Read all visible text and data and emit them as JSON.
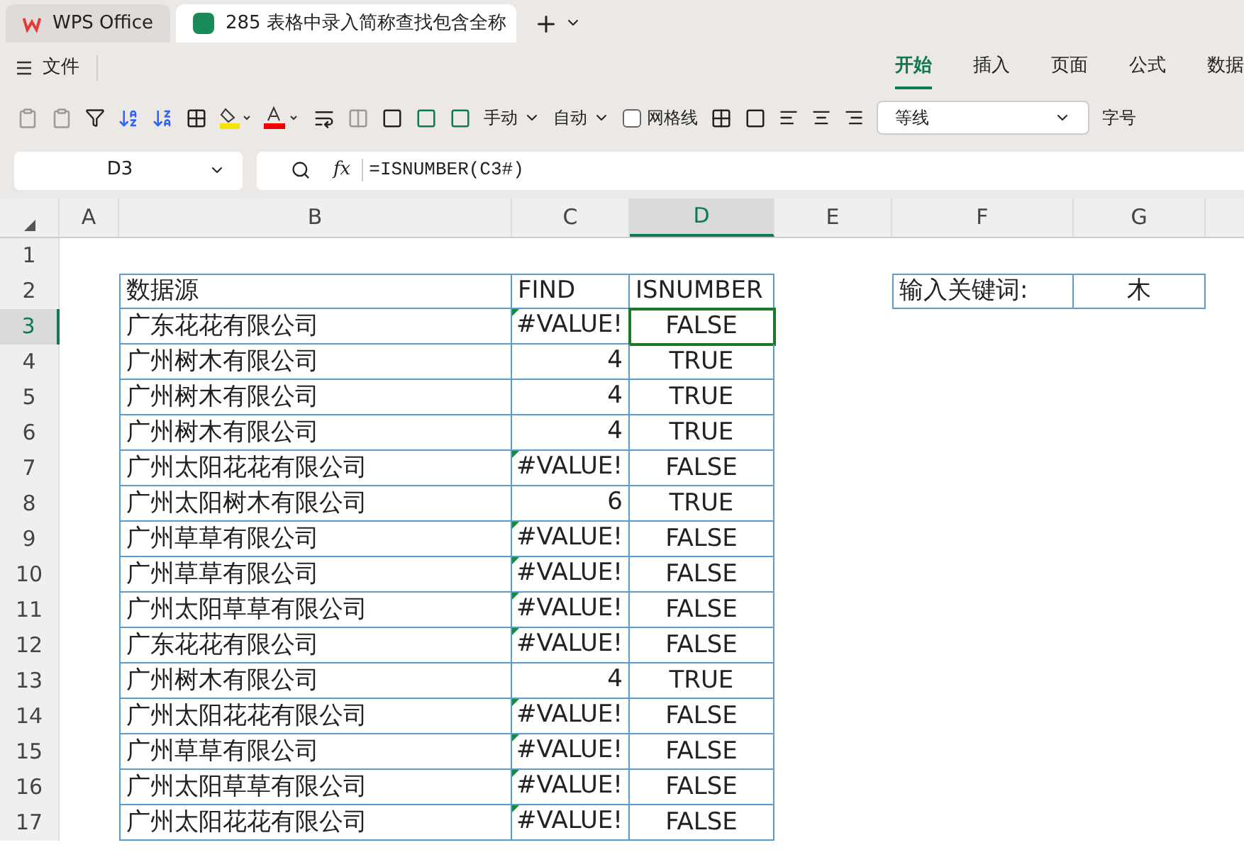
{
  "tabs": [
    {
      "kind": "home",
      "label": "WPS Office",
      "selected": false
    },
    {
      "kind": "doc",
      "label": "285 表格中录入简称查找包含全称",
      "selected": true
    }
  ],
  "menu": {
    "file": "文件",
    "ribbon_tabs": [
      {
        "label": "开始",
        "selected": true
      },
      {
        "label": "插入",
        "selected": false
      },
      {
        "label": "页面",
        "selected": false
      },
      {
        "label": "公式",
        "selected": false
      },
      {
        "label": "数据",
        "selected": false
      }
    ]
  },
  "toolbar": {
    "row_height": "手动",
    "col_width": "自动",
    "gridlines": {
      "label": "网格线",
      "checked": false
    },
    "font": "等线",
    "font_size_label": "字号"
  },
  "formula_bar": {
    "cell_ref": "D3",
    "fx": "fx",
    "formula": "=ISNUMBER(C3#)"
  },
  "sheet": {
    "columns": [
      {
        "label": "A",
        "selected": false
      },
      {
        "label": "B",
        "selected": false
      },
      {
        "label": "C",
        "selected": false
      },
      {
        "label": "D",
        "selected": true
      },
      {
        "label": "E",
        "selected": false
      },
      {
        "label": "F",
        "selected": false
      },
      {
        "label": "G",
        "selected": false
      }
    ],
    "header": {
      "b": "数据源",
      "c": "FIND",
      "d": "ISNUMBER",
      "f": "输入关键词:",
      "g": "木"
    },
    "rows": [
      {
        "num": "1",
        "selected": false
      },
      {
        "num": "2",
        "selected": false
      },
      {
        "num": "3",
        "selected": true,
        "b": "广东花花有限公司",
        "c": "#VALUE!",
        "flag": true,
        "d": "FALSE"
      },
      {
        "num": "4",
        "selected": false,
        "b": "广州树木有限公司",
        "c": "4",
        "flag": false,
        "d": "TRUE"
      },
      {
        "num": "5",
        "selected": false,
        "b": "广州树木有限公司",
        "c": "4",
        "flag": false,
        "d": "TRUE"
      },
      {
        "num": "6",
        "selected": false,
        "b": "广州树木有限公司",
        "c": "4",
        "flag": false,
        "d": "TRUE"
      },
      {
        "num": "7",
        "selected": false,
        "b": "广州太阳花花有限公司",
        "c": "#VALUE!",
        "flag": true,
        "d": "FALSE"
      },
      {
        "num": "8",
        "selected": false,
        "b": "广州太阳树木有限公司",
        "c": "6",
        "flag": false,
        "d": "TRUE"
      },
      {
        "num": "9",
        "selected": false,
        "b": "广州草草有限公司",
        "c": "#VALUE!",
        "flag": true,
        "d": "FALSE"
      },
      {
        "num": "10",
        "selected": false,
        "b": "广州草草有限公司",
        "c": "#VALUE!",
        "flag": true,
        "d": "FALSE"
      },
      {
        "num": "11",
        "selected": false,
        "b": "广州太阳草草有限公司",
        "c": "#VALUE!",
        "flag": true,
        "d": "FALSE"
      },
      {
        "num": "12",
        "selected": false,
        "b": "广东花花有限公司",
        "c": "#VALUE!",
        "flag": true,
        "d": "FALSE"
      },
      {
        "num": "13",
        "selected": false,
        "b": "广州树木有限公司",
        "c": "4",
        "flag": false,
        "d": "TRUE"
      },
      {
        "num": "14",
        "selected": false,
        "b": "广州太阳花花有限公司",
        "c": "#VALUE!",
        "flag": true,
        "d": "FALSE"
      },
      {
        "num": "15",
        "selected": false,
        "b": "广州草草有限公司",
        "c": "#VALUE!",
        "flag": true,
        "d": "FALSE"
      },
      {
        "num": "16",
        "selected": false,
        "b": "广州太阳草草有限公司",
        "c": "#VALUE!",
        "flag": true,
        "d": "FALSE"
      },
      {
        "num": "17",
        "selected": false,
        "b": "广州太阳花花有限公司",
        "c": "#VALUE!",
        "flag": true,
        "d": "FALSE"
      }
    ]
  }
}
